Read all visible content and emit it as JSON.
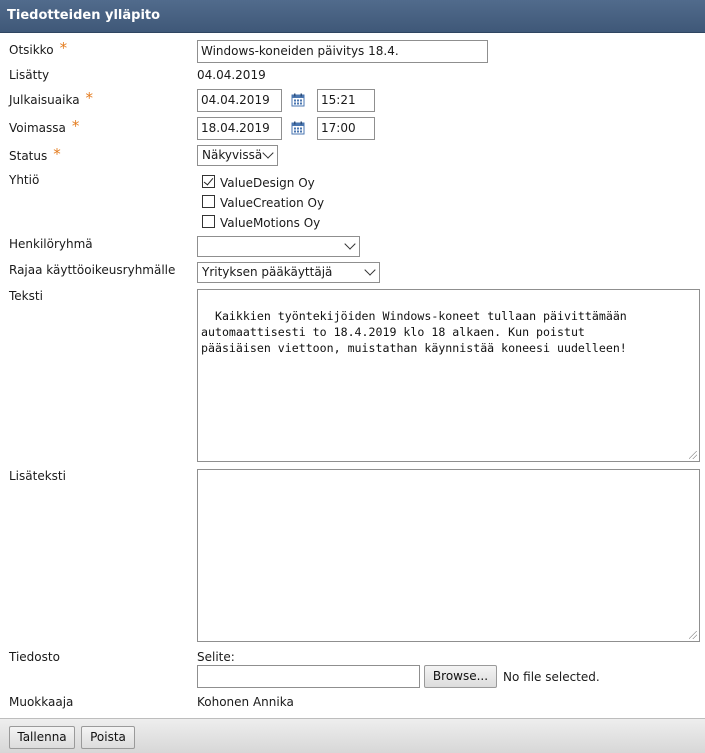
{
  "header": {
    "title": "Tiedotteiden ylläpito"
  },
  "form": {
    "otsikko": {
      "label": "Otsikko",
      "required": "*",
      "value": "Windows-koneiden päivitys 18.4."
    },
    "lisatty": {
      "label": "Lisätty",
      "value": "04.04.2019"
    },
    "julkaisuaika": {
      "label": "Julkaisuaika",
      "required": "*",
      "date": "04.04.2019",
      "time": "15:21"
    },
    "voimassa": {
      "label": "Voimassa",
      "required": "*",
      "date": "18.04.2019",
      "time": "17:00"
    },
    "status": {
      "label": "Status",
      "required": "*",
      "value": "Näkyvissä"
    },
    "yhtio": {
      "label": "Yhtiö",
      "options": [
        {
          "label": "ValueDesign Oy",
          "checked": true
        },
        {
          "label": "ValueCreation Oy",
          "checked": false
        },
        {
          "label": "ValueMotions Oy",
          "checked": false
        }
      ]
    },
    "henkiloryhma": {
      "label": "Henkilöryhmä",
      "value": ""
    },
    "rajaa": {
      "label": "Rajaa käyttöoikeusryhmälle",
      "value": "Yrityksen pääkäyttäjä"
    },
    "teksti": {
      "label": "Teksti",
      "value": "Kaikkien työntekijöiden Windows-koneet tullaan päivittämään\nautomaattisesti to 18.4.2019 klo 18 alkaen. Kun poistut\npääsiäisen viettoon, muistathan käynnistää koneesi uudelleen!"
    },
    "lisateksti": {
      "label": "Lisäteksti",
      "value": ""
    },
    "tiedosto": {
      "label": "Tiedosto",
      "selite_label": "Selite:",
      "selite_value": "",
      "browse_label": "Browse...",
      "file_status": "No file selected."
    },
    "muokkaaja": {
      "label": "Muokkaaja",
      "value": "Kohonen Annika"
    }
  },
  "footer": {
    "save_label": "Tallenna",
    "delete_label": "Poista"
  },
  "colors": {
    "header": "#4a6384",
    "required": "#e47c1f",
    "calendar_icon": "#4a76b0"
  }
}
